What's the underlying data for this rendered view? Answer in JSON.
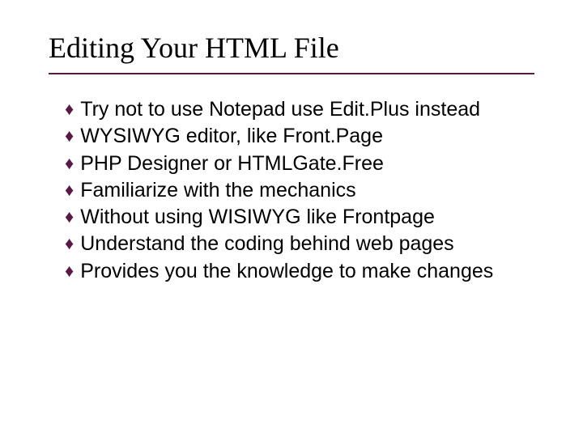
{
  "slide": {
    "title": "Editing Your HTML File",
    "bullets": [
      "Try not to use Notepad use Edit.Plus instead",
      "WYSIWYG editor, like Front.Page",
      "PHP Designer or HTMLGate.Free",
      "Familiarize with the mechanics",
      "Without using WISIWYG like Frontpage",
      "Understand the coding behind web pages",
      "Provides you the knowledge to make changes"
    ],
    "accent_color": "#5a1846"
  }
}
